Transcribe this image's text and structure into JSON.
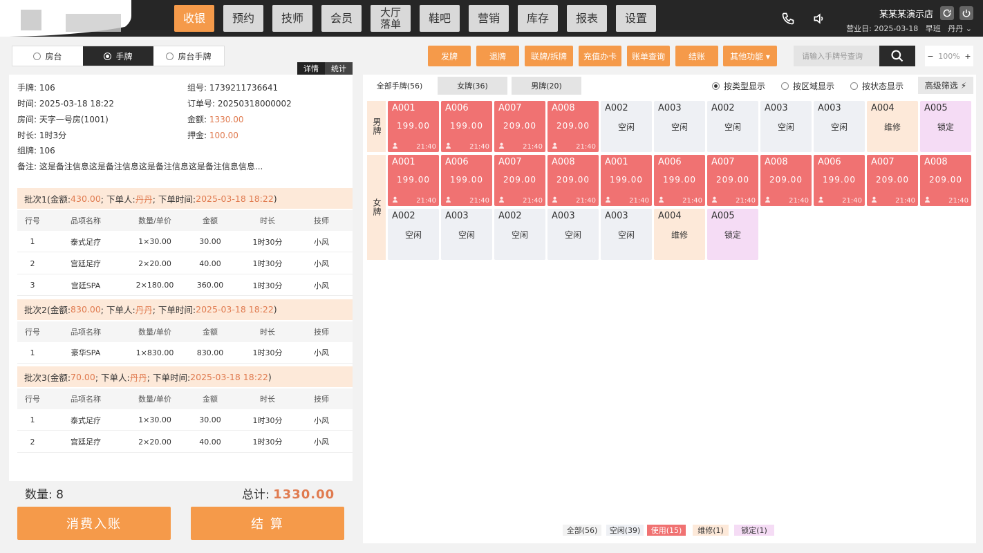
{
  "nav": {
    "items": [
      "收银",
      "预约",
      "技师",
      "会员",
      "大厅\n落单",
      "鞋吧",
      "营销",
      "库存",
      "报表",
      "设置"
    ],
    "active_index": 0
  },
  "header": {
    "store_name": "某某某演示店",
    "business_day_label": "营业日: 2025-03-18",
    "shift": "早班",
    "user": "丹丹"
  },
  "mode_tabs": {
    "items": [
      "房台",
      "手牌",
      "房台手牌"
    ],
    "selected_index": 1
  },
  "detail_tabs": [
    "详情",
    "统计"
  ],
  "order": {
    "tag_label": "手牌:",
    "tag": "106",
    "time_label": "时间:",
    "time": "2025-03-18 18:22",
    "room_label": "房间:",
    "room": "天字一号房(1001)",
    "duration_label": "时长:",
    "duration": "1时3分",
    "group_tag_label": "组牌:",
    "group_tag": "106",
    "group_label": "组号:",
    "group": "1739211736641",
    "order_no_label": "订单号:",
    "order_no": "20250318000002",
    "amount_label": "金额:",
    "amount": "1330.00",
    "deposit_label": "押金:",
    "deposit": "100.00",
    "note_label": "备注:",
    "note": "这是备注信息这是备注信息这是备注信息这是备注信息信息..."
  },
  "table_headers": [
    "行号",
    "品项名称",
    "数量/单价",
    "金额",
    "时长",
    "技师"
  ],
  "batches": [
    {
      "name": "批次1",
      "amount": "430.00",
      "by": "丹丹",
      "time": "2025-03-18 18:22",
      "rows": [
        [
          "1",
          "泰式足疗",
          "1×30.00",
          "30.00",
          "1时30分",
          "小风"
        ],
        [
          "2",
          "宫廷足疗",
          "2×20.00",
          "40.00",
          "1时30分",
          "小风"
        ],
        [
          "3",
          "宫廷SPA",
          "2×180.00",
          "360.00",
          "1时30分",
          "小风"
        ]
      ]
    },
    {
      "name": "批次2",
      "amount": "830.00",
      "by": "丹丹",
      "time": "2025-03-18 18:22",
      "rows": [
        [
          "1",
          "豪华SPA",
          "1×830.00",
          "830.00",
          "1时30分",
          "小风"
        ]
      ]
    },
    {
      "name": "批次3",
      "amount": "70.00",
      "by": "丹丹",
      "time": "2025-03-18 18:22",
      "rows": [
        [
          "1",
          "泰式足疗",
          "1×30.00",
          "30.00",
          "1时30分",
          "小风"
        ],
        [
          "2",
          "宫廷足疗",
          "2×20.00",
          "40.00",
          "1时30分",
          "小风"
        ]
      ]
    }
  ],
  "batch_text": {
    "amount_prefix": " (金额:",
    "by_prefix": "; 下单人:",
    "time_prefix": "; 下单时间:",
    "suffix": ")"
  },
  "summary": {
    "qty_label": "数量:",
    "qty": "8",
    "total_label": "总计:",
    "total": "1330.00"
  },
  "buttons": {
    "post": "消费入账",
    "checkout": "结  算"
  },
  "actions": [
    "发牌",
    "退牌",
    "联牌/拆牌",
    "充值办卡",
    "账单查询",
    "结账",
    "其他功能 ▾"
  ],
  "search": {
    "placeholder": "请输入手牌号查询"
  },
  "zoom": {
    "minus": "−",
    "value": "100%",
    "plus": "+"
  },
  "filter_tabs": [
    "全部手牌(56)",
    "女牌(36)",
    "男牌(20)"
  ],
  "display_options": [
    "按类型显示",
    "按区域显示",
    "按状态显示"
  ],
  "display_selected": 0,
  "advanced_filter": "高级筛选",
  "groups": [
    {
      "label": "男牌",
      "cards": [
        {
          "code": "A001",
          "status": "used",
          "price": "199.00",
          "time": "21:40"
        },
        {
          "code": "A006",
          "status": "used",
          "price": "199.00",
          "time": "21:40"
        },
        {
          "code": "A007",
          "status": "used",
          "price": "209.00",
          "time": "21:40"
        },
        {
          "code": "A008",
          "status": "used",
          "price": "209.00",
          "time": "21:40"
        },
        {
          "code": "A002",
          "status": "idle",
          "text": "空闲"
        },
        {
          "code": "A003",
          "status": "idle",
          "text": "空闲"
        },
        {
          "code": "A002",
          "status": "idle",
          "text": "空闲"
        },
        {
          "code": "A003",
          "status": "idle",
          "text": "空闲"
        },
        {
          "code": "A003",
          "status": "idle",
          "text": "空闲"
        },
        {
          "code": "A004",
          "status": "repair",
          "text": "维修"
        },
        {
          "code": "A005",
          "status": "locked",
          "text": "锁定"
        }
      ]
    },
    {
      "label": "女牌",
      "cards": [
        {
          "code": "A001",
          "status": "used",
          "price": "199.00",
          "time": "21:40"
        },
        {
          "code": "A006",
          "status": "used",
          "price": "199.00",
          "time": "21:40"
        },
        {
          "code": "A007",
          "status": "used",
          "price": "209.00",
          "time": "21:40"
        },
        {
          "code": "A008",
          "status": "used",
          "price": "209.00",
          "time": "21:40"
        },
        {
          "code": "A001",
          "status": "used",
          "price": "199.00",
          "time": "21:40"
        },
        {
          "code": "A006",
          "status": "used",
          "price": "199.00",
          "time": "21:40"
        },
        {
          "code": "A007",
          "status": "used",
          "price": "209.00",
          "time": "21:40"
        },
        {
          "code": "A008",
          "status": "used",
          "price": "209.00",
          "time": "21:40"
        },
        {
          "code": "A006",
          "status": "used",
          "price": "199.00",
          "time": "21:40"
        },
        {
          "code": "A007",
          "status": "used",
          "price": "209.00",
          "time": "21:40"
        },
        {
          "code": "A008",
          "status": "used",
          "price": "209.00",
          "time": "21:40"
        },
        {
          "code": "A002",
          "status": "idle",
          "text": "空闲"
        },
        {
          "code": "A003",
          "status": "idle",
          "text": "空闲"
        },
        {
          "code": "A002",
          "status": "idle",
          "text": "空闲"
        },
        {
          "code": "A003",
          "status": "idle",
          "text": "空闲"
        },
        {
          "code": "A003",
          "status": "idle",
          "text": "空闲"
        },
        {
          "code": "A004",
          "status": "repair",
          "text": "维修"
        },
        {
          "code": "A005",
          "status": "locked",
          "text": "锁定"
        }
      ]
    }
  ],
  "legend": [
    {
      "label": "全部(56)",
      "color": "#f2f2f2"
    },
    {
      "label": "空闲(39)",
      "color": "#eef0f4"
    },
    {
      "label": "使用(15)",
      "color": "#f07272"
    },
    {
      "label": "维修(1)",
      "color": "#fde9d9"
    },
    {
      "label": "锁定(1)",
      "color": "#f5dcf5"
    }
  ],
  "colors": {
    "accent": "#f59a4a",
    "used": "#f07272",
    "dark": "#262626",
    "highlight": "#e07b50"
  },
  "icons": [
    "phone-icon",
    "speaker-icon",
    "refresh-icon",
    "power-icon",
    "search-icon",
    "person-icon",
    "filter-icon"
  ]
}
